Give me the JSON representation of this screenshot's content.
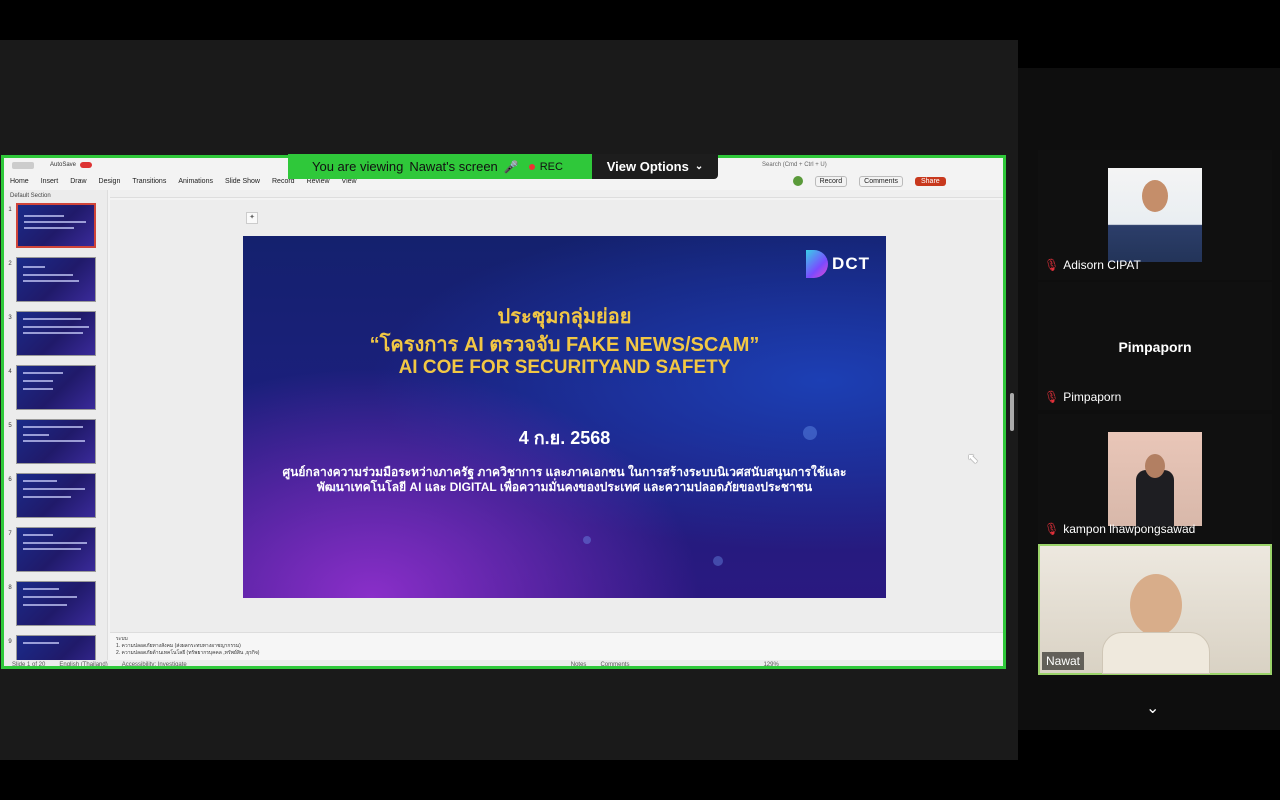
{
  "banner": {
    "viewing": "You are viewing",
    "presenter": "Nawat's screen",
    "rec": "REC",
    "view_options": "View Options"
  },
  "ppt": {
    "autosave": "AutoSave",
    "search_placeholder": "Search (Cmd + Ctrl + U)",
    "ribbon": [
      "Home",
      "Insert",
      "Draw",
      "Design",
      "Transitions",
      "Animations",
      "Slide Show",
      "Record",
      "Review",
      "View"
    ],
    "record_btn": "Record",
    "comments_btn": "Comments",
    "share_btn": "Share",
    "section": "Default Section",
    "thumb_numbers": [
      "1",
      "2",
      "3",
      "4",
      "5",
      "6",
      "7",
      "8",
      "9"
    ],
    "notes_heading": "ระบบ",
    "notes_lines": [
      "1. ความปลอดภัยทางสังคม (ส่งผลกระทบทางอาชญากรรม)",
      "2. ความปลอดภัยด้านเทคโนโลยี (ทรัพยากรบุคคล ,ทรัพย์สิน ,ธุรกิจ)"
    ],
    "status_slide": "Slide 1 of 20",
    "status_lang": "English (Thailand)",
    "status_access": "Accessibility: Investigate",
    "status_notes": "Notes",
    "status_comments": "Comments",
    "zoom": "129%"
  },
  "slide": {
    "logo": "DCT",
    "title1": "ประชุมกลุ่มย่อย",
    "title2": "“โครงการ AI ตรวจจับ FAKE NEWS/SCAM”",
    "title3": "AI COE FOR SECURITYAND SAFETY",
    "date": "4 ก.ย. 2568",
    "body1": "ศูนย์กลางความร่วมมือระหว่างภาครัฐ ภาควิชาการ และภาคเอกชน ในการสร้างระบบนิเวศสนับสนุนการใช้และ",
    "body2": "พัฒนาเทคโนโลยี AI และ DIGITAL เพื่อความมั่นคงของประเทศ และความปลอดภัยของประชาชน"
  },
  "participants": [
    {
      "name": "Adisorn CIPAT",
      "muted": true
    },
    {
      "name": "Pimpaporn",
      "display": "Pimpaporn",
      "muted": true
    },
    {
      "name": "kampon lhawpongsawad",
      "muted": true
    },
    {
      "name": "Nawat",
      "muted": false
    }
  ],
  "colors": {
    "share_border": "#2fc83a",
    "slide_title": "#f2c744",
    "mute_red": "#e0303a"
  }
}
